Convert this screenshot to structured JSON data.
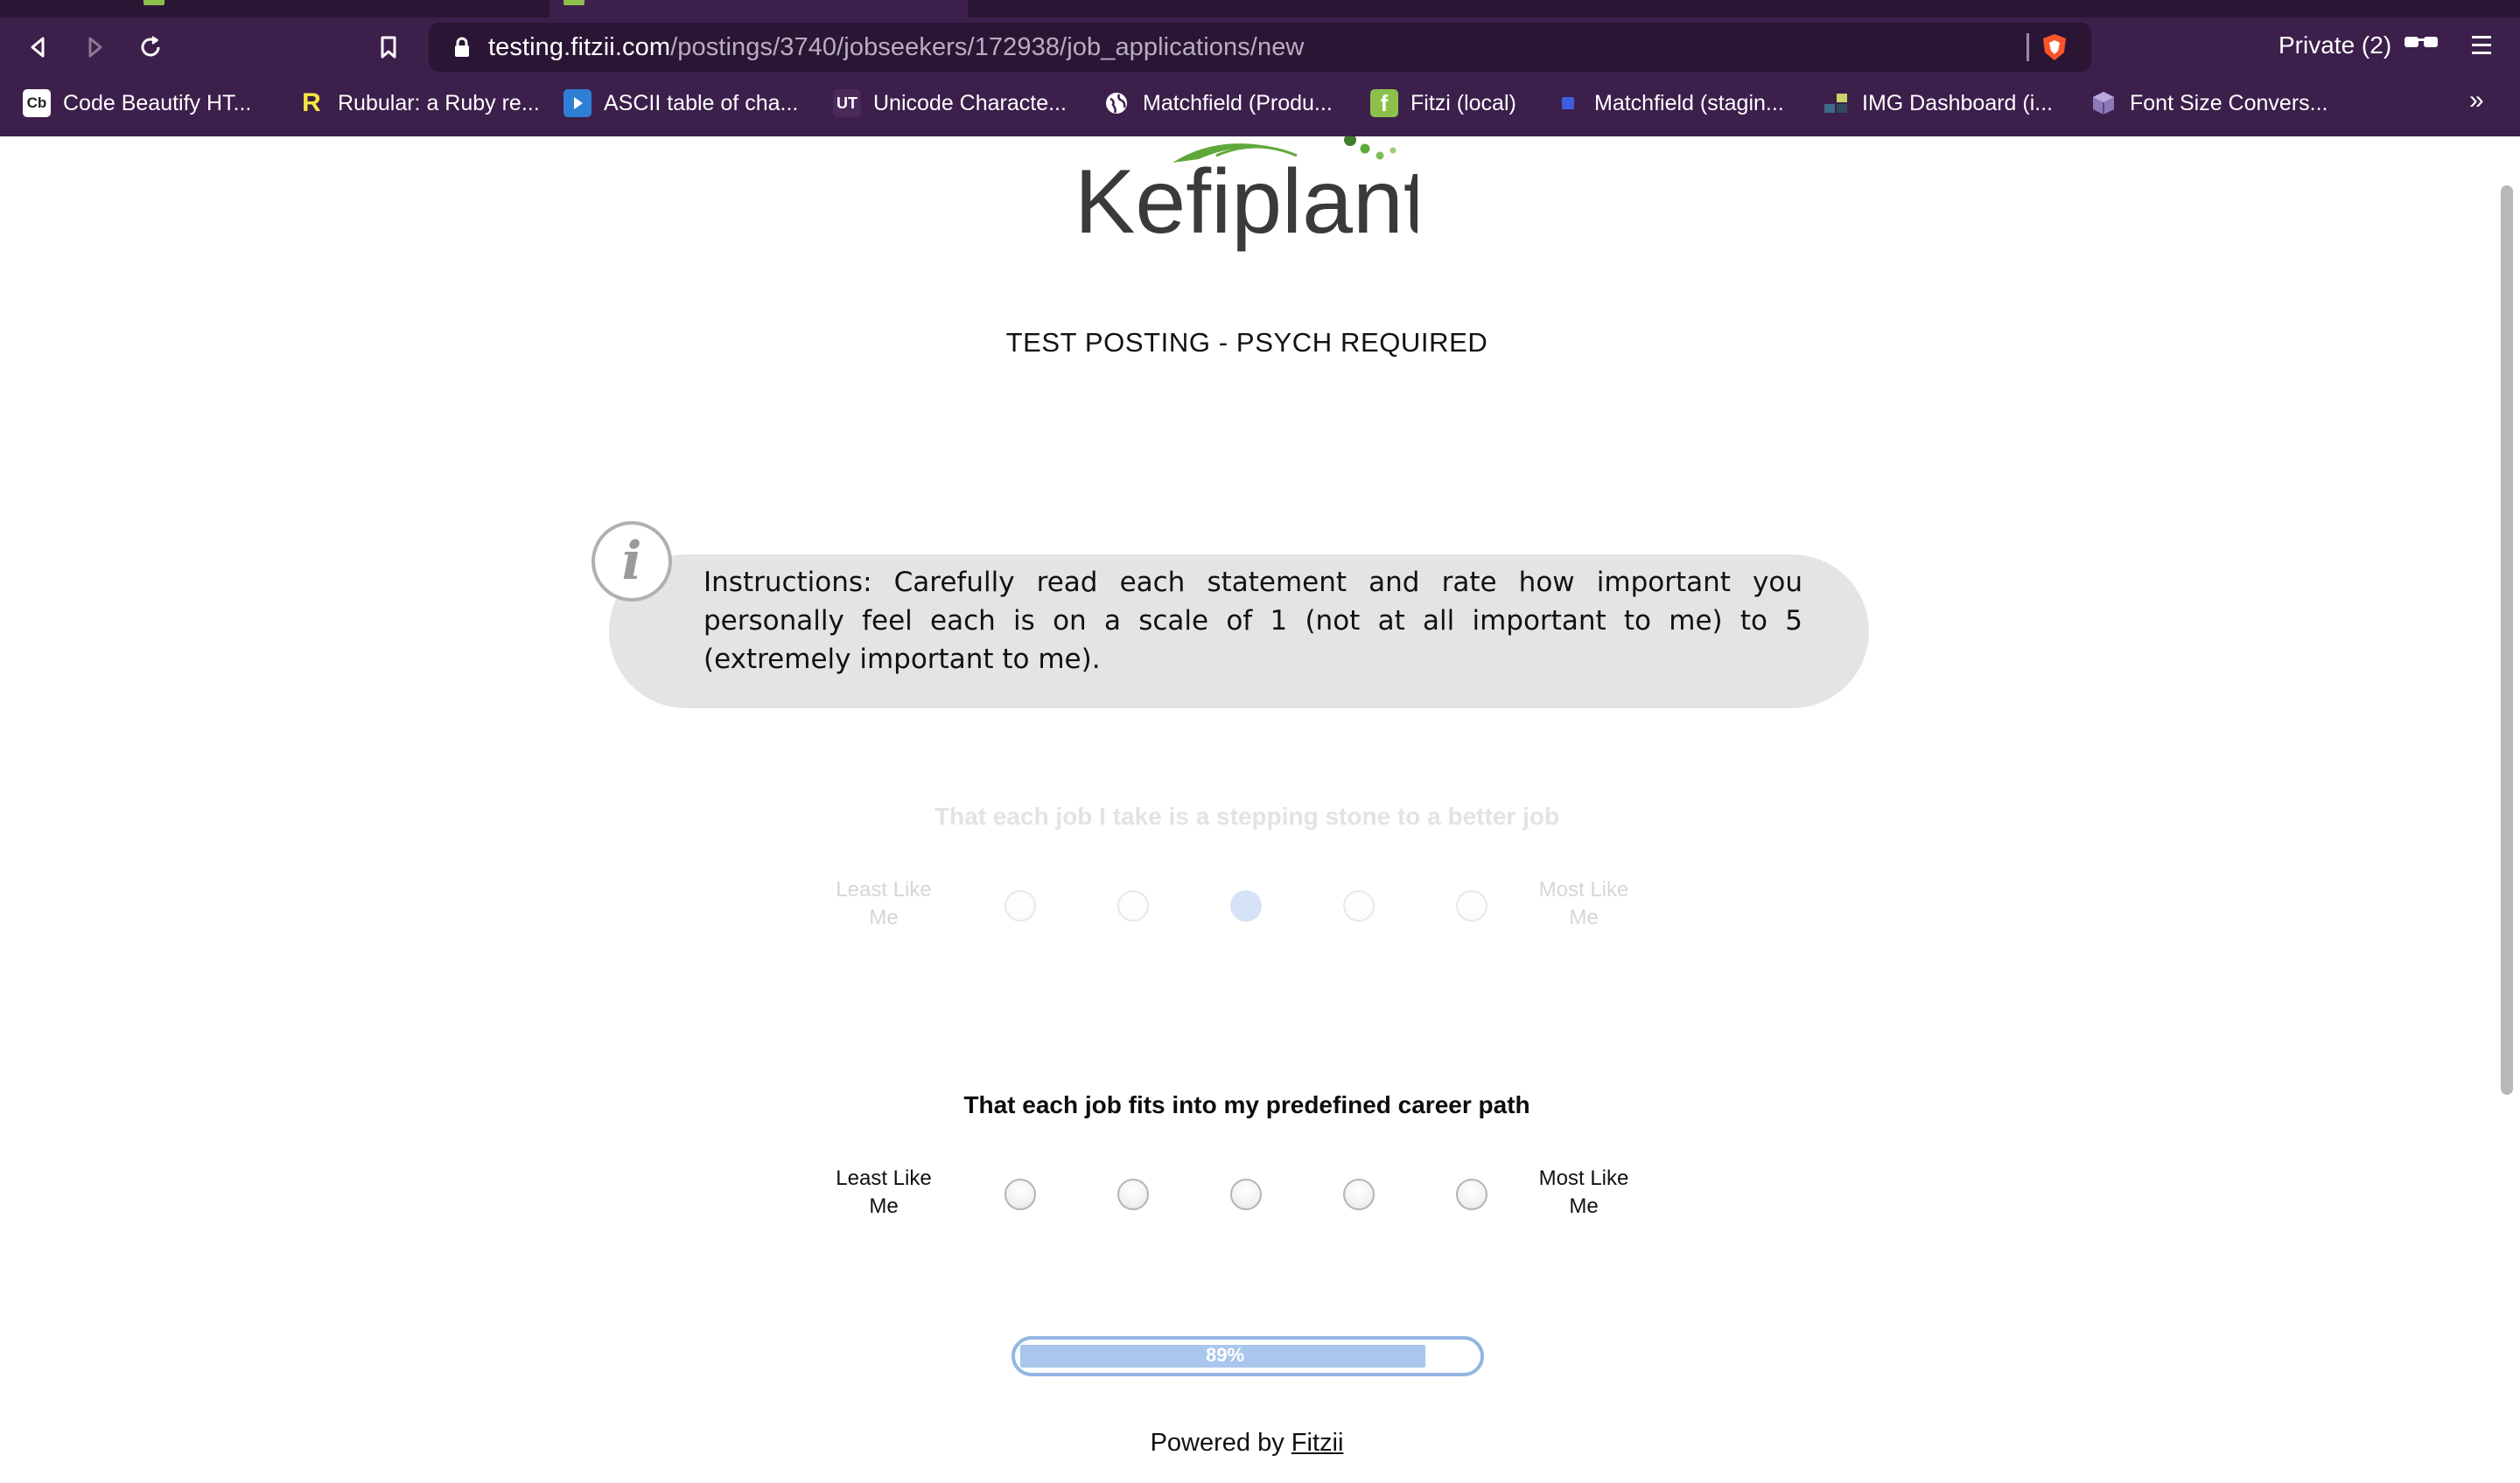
{
  "browser": {
    "url_host": "testing.fitzii.com",
    "url_path": "/postings/3740/jobseekers/172938/job_applications/new",
    "private_label": "Private (2)",
    "overflow_label": "»",
    "bookmarks": [
      {
        "label": "Code Beautify HT...",
        "icon": "Cb"
      },
      {
        "label": "Rubular: a Ruby re...",
        "icon": "R"
      },
      {
        "label": "ASCII table of cha...",
        "icon": "play"
      },
      {
        "label": "Unicode Characte...",
        "icon": "UT"
      },
      {
        "label": "Matchfield (Produ...",
        "icon": "globe"
      },
      {
        "label": "Fitzi (local)",
        "icon": "f"
      },
      {
        "label": "Matchfield (stagin...",
        "icon": "square"
      },
      {
        "label": "IMG Dashboard (i...",
        "icon": "grid"
      },
      {
        "label": "Font Size Convers...",
        "icon": "cube"
      }
    ]
  },
  "page": {
    "logo_text": "Kefiplant",
    "posting_title": "TEST POSTING - PSYCH REQUIRED",
    "instructions": "Instructions: Carefully read each statement and rate how important you personally feel each is on a scale of 1 (not at all important to me) to 5 (extremely important to me).",
    "questions": [
      {
        "text": "That each job I take is a stepping stone to a better job",
        "least_label": "Least Like Me",
        "most_label": "Most Like Me",
        "selected": 3,
        "faded": true
      },
      {
        "text": "That each job fits into my predefined career path",
        "least_label": "Least Like Me",
        "most_label": "Most Like Me",
        "selected": null,
        "faded": false
      }
    ],
    "progress_label": "89%",
    "progress_value": 0.89,
    "powered_prefix": "Powered by",
    "powered_link": "Fitzii"
  },
  "colors": {
    "chrome": "#3c1f4b",
    "urlbar": "#2a1535",
    "instructions_bg": "#e4e4e4",
    "radio_checked": "#4a86d8",
    "progress_border": "#93b6e3",
    "progress_fill": "#a9c6ec",
    "logo_green": "#5fa83a"
  }
}
